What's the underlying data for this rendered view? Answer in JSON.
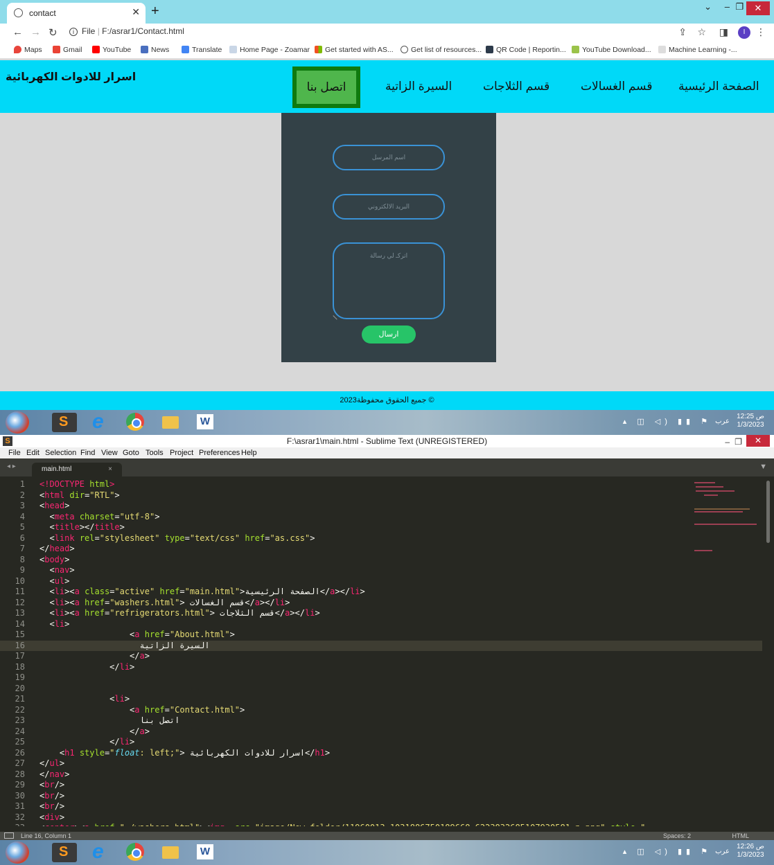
{
  "browser": {
    "tab_title": "contact",
    "url_prefix": "File",
    "url": "F:/asrar1/Contact.html",
    "profile_initial": "I",
    "bookmarks": [
      "Maps",
      "Gmail",
      "YouTube",
      "News",
      "Translate",
      "Home Page - Zoamar",
      "Get started with AS...",
      "Get list of resources...",
      "QR Code | Reportin...",
      "YouTube Download...",
      "Machine Learning -..."
    ]
  },
  "site": {
    "brand": "اسرار للادوات الكهربائية",
    "nav": {
      "contact": "اتصل بنا",
      "about": "السيرة الزاتية",
      "fridges": "قسم الثلاجات",
      "washers": "قسم الغسالات",
      "home": "الصفحة الرئيسية"
    },
    "form": {
      "name_placeholder": "اسم المرسل",
      "email_placeholder": "البريد الالكتروني",
      "message_placeholder": "اتركـ لي رسالة",
      "send_label": "ارسال"
    },
    "footer": "© جميع الحقوق محفوظة2023"
  },
  "taskbar_top": {
    "time": "12:25 ص",
    "date": "1/3/2023",
    "lang": "عرب"
  },
  "taskbar_bottom": {
    "time": "12:26 ص",
    "date": "1/3/2023",
    "lang": "عرب"
  },
  "sublime": {
    "title": "F:\\asrar1\\main.html - Sublime Text (UNREGISTERED)",
    "menu": [
      "File",
      "Edit",
      "Selection",
      "Find",
      "View",
      "Goto",
      "Tools",
      "Project",
      "Preferences",
      "Help"
    ],
    "tab": "main.html",
    "status_left": "Line 16, Column 1",
    "status_spaces": "Spaces: 2",
    "status_syntax": "HTML"
  }
}
